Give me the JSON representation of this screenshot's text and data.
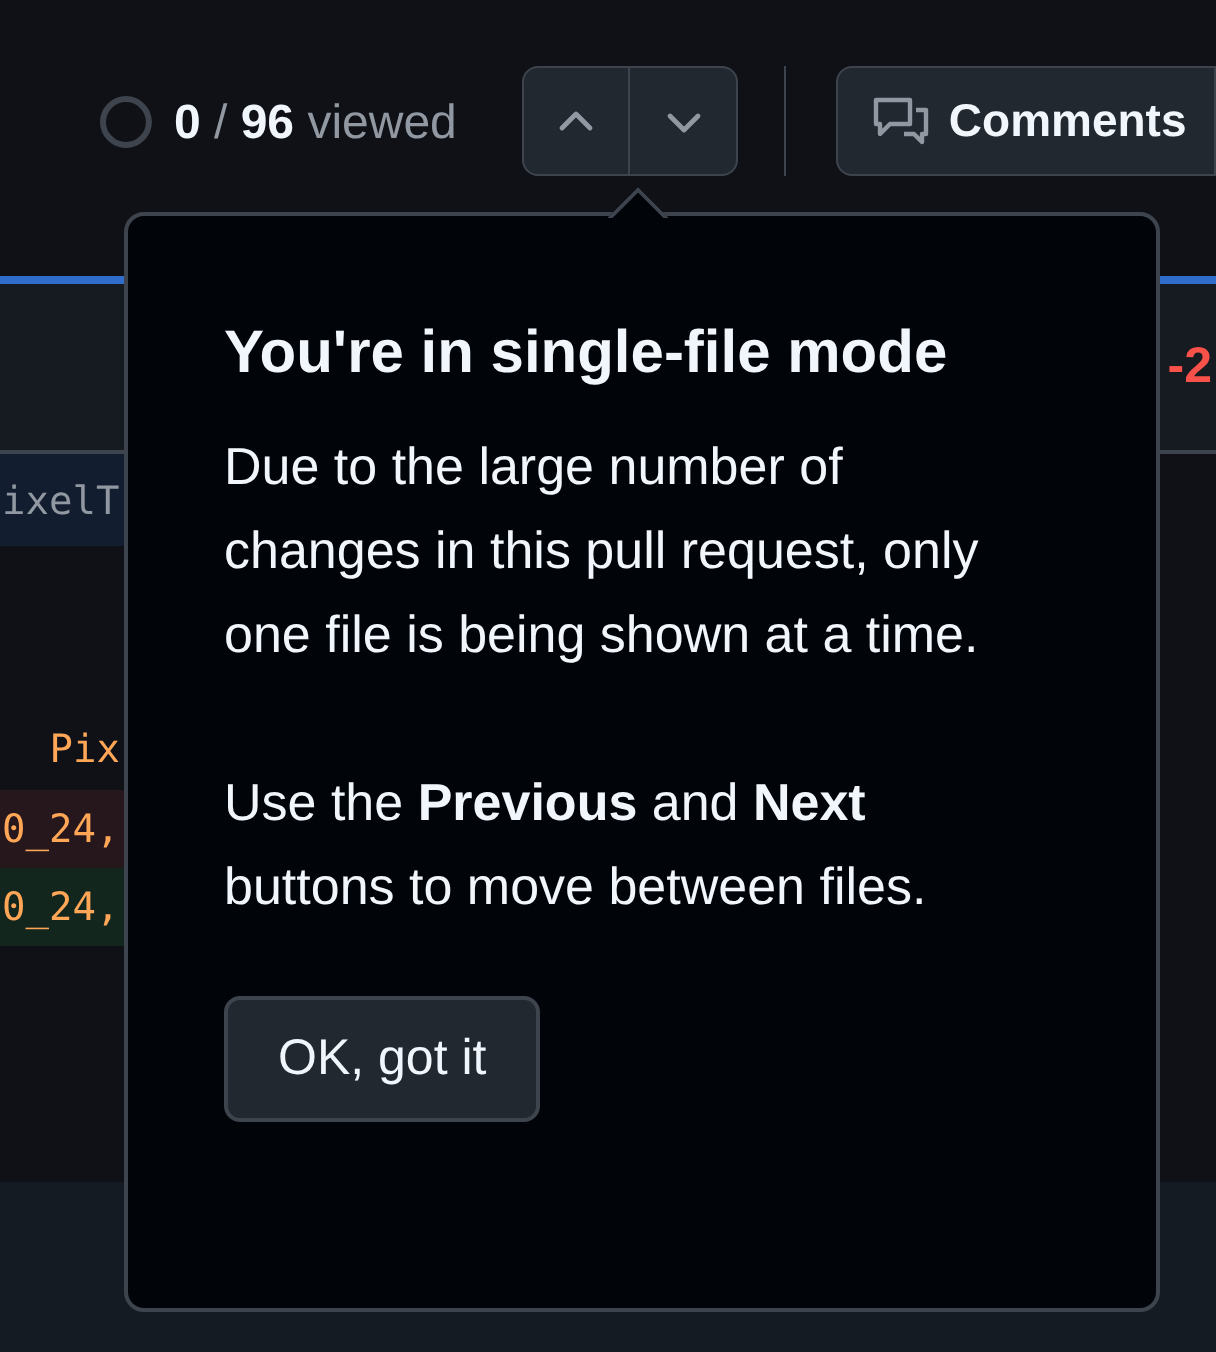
{
  "toolbar": {
    "progress": {
      "count": "0",
      "separator": "/",
      "total": "96",
      "label": "viewed"
    },
    "comments_button": "Comments"
  },
  "diff": {
    "hunk_header": "ixelT",
    "deletions": "-2",
    "lines": [
      {
        "kind": "context",
        "text": "Pix"
      },
      {
        "kind": "deletion",
        "text": "0_24,"
      },
      {
        "kind": "addition",
        "text": "0_24,"
      }
    ]
  },
  "popover": {
    "title": "You're in single-file mode",
    "paragraphs": [
      "Due to the large number of changes in this pull request, only one file is being shown at a time.",
      "Use the **Previous** and **Next** buttons to move between files."
    ],
    "button": "OK, got it"
  }
}
